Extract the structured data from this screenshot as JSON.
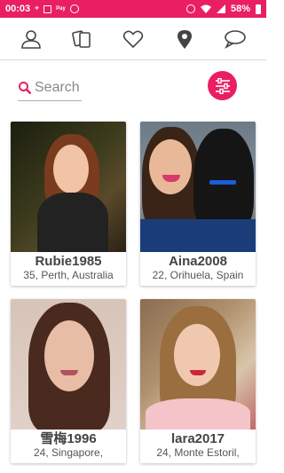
{
  "status_bar": {
    "time": "00:03",
    "battery": "58%",
    "color": "#e91e63"
  },
  "nav": {
    "items": [
      {
        "icon": "profile-icon"
      },
      {
        "icon": "cards-icon"
      },
      {
        "icon": "heart-icon"
      },
      {
        "icon": "location-pin-icon"
      },
      {
        "icon": "chat-bubble-icon"
      }
    ]
  },
  "search": {
    "placeholder": "Search",
    "icon": "search-icon"
  },
  "filter": {
    "icon": "filter-sliders-icon",
    "color": "#e91e63"
  },
  "profiles": [
    {
      "name": "Rubie1985",
      "details": "35, Perth, Australia"
    },
    {
      "name": "Aina2008",
      "details": "22, Orihuela, Spain"
    },
    {
      "name": "雪梅1996",
      "details": "24, Singapore,"
    },
    {
      "name": "lara2017",
      "details": "24, Monte Estoril,"
    }
  ]
}
